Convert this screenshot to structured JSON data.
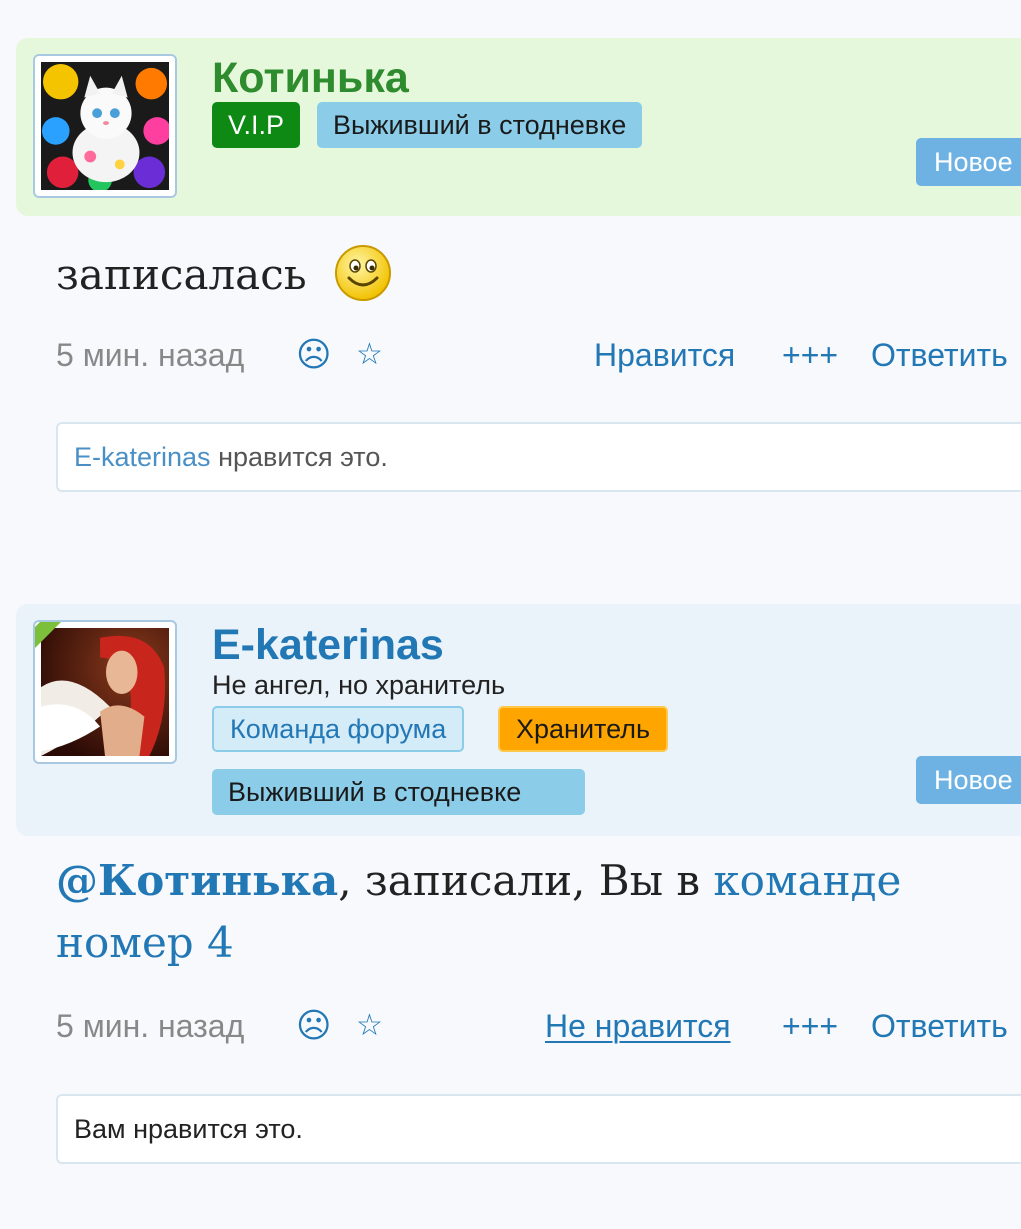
{
  "posts": [
    {
      "author": "Котинька",
      "badges": [
        "V.I.P",
        "Выживший в стодневке"
      ],
      "new_label": "Новое",
      "message": "записалась",
      "time": "5 мин. назад",
      "sad_icon": "☹",
      "star_icon": "☆",
      "actions": [
        "Нравится",
        "+++",
        "Ответить"
      ],
      "likes_user": "E-katerinas",
      "likes_text": " нравится это."
    },
    {
      "author": "E-katerinas",
      "status": "Не ангел, но хранитель",
      "badges": [
        "Команда форума",
        "Хранитель",
        "Выживший в стодневке"
      ],
      "new_label": "Новое",
      "message_mention": "@Котинька",
      "message_mid": ", записали, Вы в ",
      "message_link_1": "команде",
      "message_link_2": "номер 4",
      "time": "5 мин. назад",
      "sad_icon": "☹",
      "star_icon": "☆",
      "actions": [
        "Не нравится",
        "+++",
        "Ответить"
      ],
      "likes_text": "Вам нравится это."
    }
  ],
  "colors": {
    "vip_green": "#0e8a14",
    "link_blue": "#2277b5",
    "badge_blue": "#8bcde9",
    "keeper_orange": "#ffa500",
    "header1_bg": "#e6f8dc",
    "header2_bg": "#eaf3f9"
  }
}
